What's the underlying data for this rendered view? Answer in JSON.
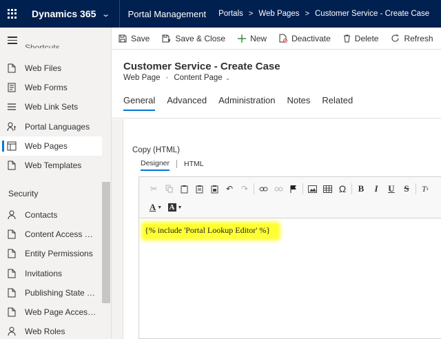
{
  "topbar": {
    "brand": "Dynamics 365",
    "app_name": "Portal Management",
    "breadcrumbs": [
      "Portals",
      "Web Pages",
      "Customer Service - Create Case"
    ]
  },
  "sidebar": {
    "shortcuts_partial": "Shortcuts",
    "items_top": [
      {
        "label": "Web Files",
        "icon": "file-icon"
      },
      {
        "label": "Web Forms",
        "icon": "form-icon"
      },
      {
        "label": "Web Link Sets",
        "icon": "list-icon"
      },
      {
        "label": "Portal Languages",
        "icon": "language-icon"
      },
      {
        "label": "Web Pages",
        "icon": "webpage-icon",
        "active": true
      },
      {
        "label": "Web Templates",
        "icon": "template-icon"
      }
    ],
    "group_security": "Security",
    "items_security": [
      {
        "label": "Contacts",
        "icon": "person-icon"
      },
      {
        "label": "Content Access Le...",
        "icon": "document-icon"
      },
      {
        "label": "Entity Permissions",
        "icon": "document-icon"
      },
      {
        "label": "Invitations",
        "icon": "document-icon"
      },
      {
        "label": "Publishing State Tr...",
        "icon": "document-icon"
      },
      {
        "label": "Web Page Access ...",
        "icon": "document-icon"
      },
      {
        "label": "Web Roles",
        "icon": "person-icon"
      }
    ]
  },
  "commands": {
    "save": "Save",
    "save_close": "Save & Close",
    "new": "New",
    "deactivate": "Deactivate",
    "delete": "Delete",
    "refresh": "Refresh"
  },
  "record": {
    "title": "Customer Service - Create Case",
    "entity": "Web Page",
    "form": "Content Page"
  },
  "tabs": [
    "General",
    "Advanced",
    "Administration",
    "Notes",
    "Related"
  ],
  "field": {
    "label": "Copy (HTML)",
    "editor_tabs": [
      "Designer",
      "HTML"
    ],
    "content": "{% include 'Portal Lookup Editor' %}"
  },
  "colors": {
    "topbar": "#002050",
    "accent": "#0078d4",
    "highlight": "#ffff33"
  }
}
